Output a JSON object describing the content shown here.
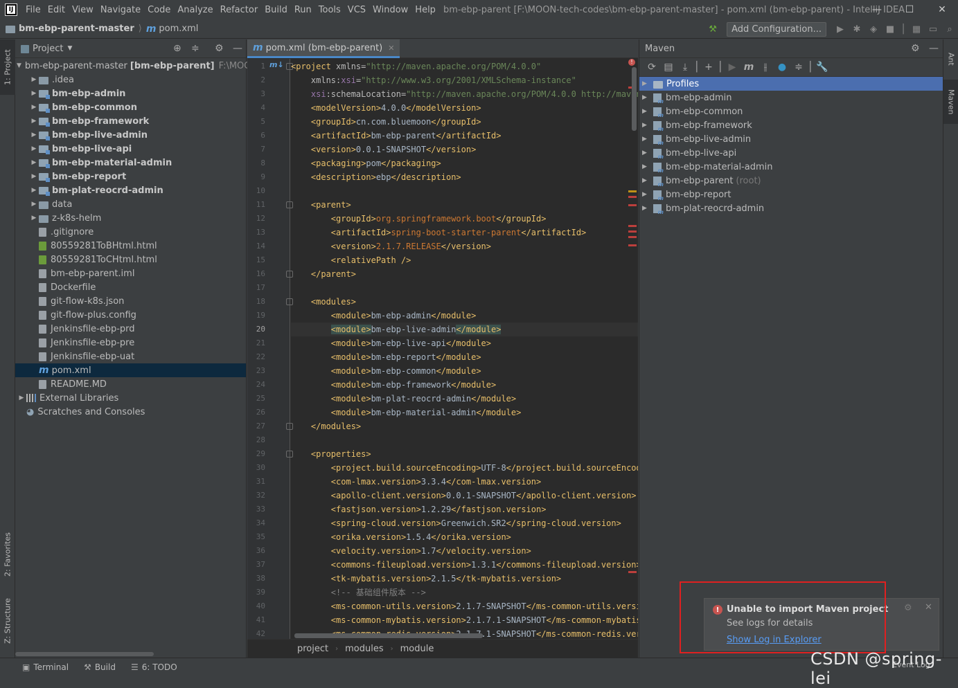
{
  "window": {
    "title": "bm-ebp-parent [F:\\MOON-tech-codes\\bm-ebp-parent-master] - pom.xml (bm-ebp-parent) - IntelliJ IDEA",
    "menu": [
      "File",
      "Edit",
      "View",
      "Navigate",
      "Code",
      "Analyze",
      "Refactor",
      "Build",
      "Run",
      "Tools",
      "VCS",
      "Window",
      "Help"
    ],
    "minimize": "—",
    "maximize": "☐",
    "close": "✕"
  },
  "nav": {
    "root": "bm-ebp-parent-master",
    "file": "pom.xml",
    "add_config": "Add Configuration..."
  },
  "left_tabs": {
    "project": "1: Project",
    "favorites": "2: Favorites",
    "structure": "Z: Structure"
  },
  "right_tabs": {
    "ant": "Ant",
    "maven": "Maven"
  },
  "project": {
    "header": "Project",
    "root_name": "bm-ebp-parent-master",
    "root_module": "[bm-ebp-parent]",
    "root_path": "F:\\MOO",
    "items": [
      {
        "label": ".idea",
        "kind": "folder",
        "bold": false
      },
      {
        "label": "bm-ebp-admin",
        "kind": "module",
        "bold": true
      },
      {
        "label": "bm-ebp-common",
        "kind": "module",
        "bold": true
      },
      {
        "label": "bm-ebp-framework",
        "kind": "module",
        "bold": true
      },
      {
        "label": "bm-ebp-live-admin",
        "kind": "module",
        "bold": true
      },
      {
        "label": "bm-ebp-live-api",
        "kind": "module",
        "bold": true
      },
      {
        "label": "bm-ebp-material-admin",
        "kind": "module",
        "bold": true
      },
      {
        "label": "bm-ebp-report",
        "kind": "module",
        "bold": true
      },
      {
        "label": "bm-plat-reocrd-admin",
        "kind": "module",
        "bold": true
      },
      {
        "label": "data",
        "kind": "folder",
        "bold": false
      },
      {
        "label": "z-k8s-helm",
        "kind": "folder",
        "bold": false
      },
      {
        "label": ".gitignore",
        "kind": "file"
      },
      {
        "label": "80559281ToBHtml.html",
        "kind": "html"
      },
      {
        "label": "80559281ToCHtml.html",
        "kind": "html"
      },
      {
        "label": "bm-ebp-parent.iml",
        "kind": "file"
      },
      {
        "label": "Dockerfile",
        "kind": "file"
      },
      {
        "label": "git-flow-k8s.json",
        "kind": "file"
      },
      {
        "label": "git-flow-plus.config",
        "kind": "file"
      },
      {
        "label": "Jenkinsfile-ebp-prd",
        "kind": "file"
      },
      {
        "label": "Jenkinsfile-ebp-pre",
        "kind": "file"
      },
      {
        "label": "Jenkinsfile-ebp-uat",
        "kind": "file"
      },
      {
        "label": "pom.xml",
        "kind": "pom"
      },
      {
        "label": "README.MD",
        "kind": "file"
      }
    ],
    "external": "External Libraries",
    "scratches": "Scratches and Consoles"
  },
  "editor": {
    "tab": "pom.xml (bm-ebp-parent)",
    "current_line": 20,
    "crumbs": [
      "project",
      "modules",
      "module"
    ]
  },
  "code_lines": [
    {
      "n": 1,
      "parts": [
        [
          "tg",
          "<project "
        ],
        [
          "at",
          "xmlns="
        ],
        [
          "st",
          "\"http://maven.apache.org/POM/4.0.0\""
        ]
      ]
    },
    {
      "n": 2,
      "parts": [
        [
          "at",
          "    xmlns:"
        ],
        [
          "ns",
          "xsi"
        ],
        [
          "at",
          "="
        ],
        [
          "st",
          "\"http://www.w3.org/2001/XMLSchema-instance\""
        ]
      ]
    },
    {
      "n": 3,
      "parts": [
        [
          "ns",
          "    xsi"
        ],
        [
          "at",
          ":schemaLocation="
        ],
        [
          "st",
          "\"http://maven.apache.org/POM/4.0.0 http://maven.a"
        ]
      ]
    },
    {
      "n": 4,
      "parts": [
        [
          "tg",
          "    <modelVersion>"
        ],
        [
          "",
          "4.0.0"
        ],
        [
          "tg",
          "</modelVersion>"
        ]
      ]
    },
    {
      "n": 5,
      "parts": [
        [
          "tg",
          "    <groupId>"
        ],
        [
          "",
          "cn.com.bluemoon"
        ],
        [
          "tg",
          "</groupId>"
        ]
      ]
    },
    {
      "n": 6,
      "parts": [
        [
          "tg",
          "    <artifactId>"
        ],
        [
          "",
          "bm-ebp-parent"
        ],
        [
          "tg",
          "</artifactId>"
        ]
      ]
    },
    {
      "n": 7,
      "parts": [
        [
          "tg",
          "    <version>"
        ],
        [
          "",
          "0.0.1-SNAPSHOT"
        ],
        [
          "tg",
          "</version>"
        ]
      ]
    },
    {
      "n": 8,
      "parts": [
        [
          "tg",
          "    <packaging>"
        ],
        [
          "",
          "pom"
        ],
        [
          "tg",
          "</packaging>"
        ]
      ]
    },
    {
      "n": 9,
      "parts": [
        [
          "tg",
          "    <description>"
        ],
        [
          "",
          "ebp"
        ],
        [
          "tg",
          "</description>"
        ]
      ]
    },
    {
      "n": 10,
      "parts": []
    },
    {
      "n": 11,
      "parts": [
        [
          "tg",
          "    <parent>"
        ]
      ]
    },
    {
      "n": 12,
      "parts": [
        [
          "tg",
          "        <groupId>"
        ],
        [
          "rd",
          "org.springframework.boot"
        ],
        [
          "tg",
          "</groupId>"
        ]
      ]
    },
    {
      "n": 13,
      "parts": [
        [
          "tg",
          "        <artifactId>"
        ],
        [
          "rd",
          "spring-boot-starter-parent"
        ],
        [
          "tg",
          "</artifactId>"
        ]
      ]
    },
    {
      "n": 14,
      "parts": [
        [
          "tg",
          "        <version>"
        ],
        [
          "rd",
          "2.1.7.RELEASE"
        ],
        [
          "tg",
          "</version>"
        ]
      ]
    },
    {
      "n": 15,
      "parts": [
        [
          "tg",
          "        <relativePath />"
        ]
      ]
    },
    {
      "n": 16,
      "parts": [
        [
          "tg",
          "    </parent>"
        ]
      ]
    },
    {
      "n": 17,
      "parts": []
    },
    {
      "n": 18,
      "parts": [
        [
          "tg",
          "    <modules>"
        ]
      ]
    },
    {
      "n": 19,
      "parts": [
        [
          "tg",
          "        <module>"
        ],
        [
          "",
          "bm-ebp-admin"
        ],
        [
          "tg",
          "</module>"
        ]
      ]
    },
    {
      "n": 20,
      "parts": [
        [
          "",
          "        "
        ],
        [
          "tg hl",
          "<module>"
        ],
        [
          "",
          "bm-ebp-live-admin"
        ],
        [
          "tg hl",
          "</module>"
        ]
      ]
    },
    {
      "n": 21,
      "parts": [
        [
          "tg",
          "        <module>"
        ],
        [
          "",
          "bm-ebp-live-api"
        ],
        [
          "tg",
          "</module>"
        ]
      ]
    },
    {
      "n": 22,
      "parts": [
        [
          "tg",
          "        <module>"
        ],
        [
          "",
          "bm-ebp-report"
        ],
        [
          "tg",
          "</module>"
        ]
      ]
    },
    {
      "n": 23,
      "parts": [
        [
          "tg",
          "        <module>"
        ],
        [
          "",
          "bm-ebp-common"
        ],
        [
          "tg",
          "</module>"
        ]
      ]
    },
    {
      "n": 24,
      "parts": [
        [
          "tg",
          "        <module>"
        ],
        [
          "",
          "bm-ebp-framework"
        ],
        [
          "tg",
          "</module>"
        ]
      ]
    },
    {
      "n": 25,
      "parts": [
        [
          "tg",
          "        <module>"
        ],
        [
          "",
          "bm-plat-reocrd-admin"
        ],
        [
          "tg",
          "</module>"
        ]
      ]
    },
    {
      "n": 26,
      "parts": [
        [
          "tg",
          "        <module>"
        ],
        [
          "",
          "bm-ebp-material-admin"
        ],
        [
          "tg",
          "</module>"
        ]
      ]
    },
    {
      "n": 27,
      "parts": [
        [
          "tg",
          "    </modules>"
        ]
      ]
    },
    {
      "n": 28,
      "parts": []
    },
    {
      "n": 29,
      "parts": [
        [
          "tg",
          "    <properties>"
        ]
      ]
    },
    {
      "n": 30,
      "parts": [
        [
          "tg",
          "        <project.build.sourceEncoding>"
        ],
        [
          "",
          "UTF-8"
        ],
        [
          "tg",
          "</project.build.sourceEncodi"
        ]
      ]
    },
    {
      "n": 31,
      "parts": [
        [
          "tg",
          "        <com-lmax.version>"
        ],
        [
          "",
          "3.3.4"
        ],
        [
          "tg",
          "</com-lmax.version>"
        ]
      ]
    },
    {
      "n": 32,
      "parts": [
        [
          "tg",
          "        <apollo-client.version>"
        ],
        [
          "",
          "0.0.1-SNAPSHOT"
        ],
        [
          "tg",
          "</apollo-client.version>"
        ]
      ]
    },
    {
      "n": 33,
      "parts": [
        [
          "tg",
          "        <fastjson.version>"
        ],
        [
          "",
          "1.2.29"
        ],
        [
          "tg",
          "</fastjson.version>"
        ]
      ]
    },
    {
      "n": 34,
      "parts": [
        [
          "tg",
          "        <spring-cloud.version>"
        ],
        [
          "",
          "Greenwich.SR2"
        ],
        [
          "tg",
          "</spring-cloud.version>"
        ]
      ]
    },
    {
      "n": 35,
      "parts": [
        [
          "tg",
          "        <orika.version>"
        ],
        [
          "",
          "1.5.4"
        ],
        [
          "tg",
          "</orika.version>"
        ]
      ]
    },
    {
      "n": 36,
      "parts": [
        [
          "tg",
          "        <velocity.version>"
        ],
        [
          "",
          "1.7"
        ],
        [
          "tg",
          "</velocity.version>"
        ]
      ]
    },
    {
      "n": 37,
      "parts": [
        [
          "tg",
          "        <commons-fileupload.version>"
        ],
        [
          "",
          "1.3.1"
        ],
        [
          "tg",
          "</commons-fileupload.version>"
        ]
      ]
    },
    {
      "n": 38,
      "parts": [
        [
          "tg",
          "        <tk-mybatis.version>"
        ],
        [
          "",
          "2.1.5"
        ],
        [
          "tg",
          "</tk-mybatis.version>"
        ]
      ]
    },
    {
      "n": 39,
      "parts": [
        [
          "cm",
          "        <!-- 基础组件版本 -->"
        ]
      ]
    },
    {
      "n": 40,
      "parts": [
        [
          "tg",
          "        <ms-common-utils.version>"
        ],
        [
          "",
          "2.1.7-SNAPSHOT"
        ],
        [
          "tg",
          "</ms-common-utils.versio"
        ]
      ]
    },
    {
      "n": 41,
      "parts": [
        [
          "tg",
          "        <ms-common-mybatis.version>"
        ],
        [
          "",
          "2.1.7.1-SNAPSHOT"
        ],
        [
          "tg",
          "</ms-common-mybatis."
        ]
      ]
    },
    {
      "n": 42,
      "parts": [
        [
          "tg",
          "        <ms-common-redis.version>"
        ],
        [
          "",
          "2.1.7.1-SNAPSHOT"
        ],
        [
          "tg",
          "</ms-common-redis.vers"
        ]
      ]
    }
  ],
  "maven": {
    "header": "Maven",
    "profiles": "Profiles",
    "items": [
      "bm-ebp-admin",
      "bm-ebp-common",
      "bm-ebp-framework",
      "bm-ebp-live-admin",
      "bm-ebp-live-api",
      "bm-ebp-material-admin",
      "bm-ebp-parent",
      "bm-ebp-report",
      "bm-plat-reocrd-admin"
    ],
    "root_label": "(root)"
  },
  "notification": {
    "title": "Unable to import Maven project",
    "detail": "See logs for details",
    "link": "Show Log in Explorer"
  },
  "statusbar": {
    "terminal": "Terminal",
    "build": "Build",
    "todo": "6: TODO",
    "event_log": "Event Log"
  },
  "watermark": "CSDN @spring-lei",
  "colors": {
    "accent": "#4a88c7",
    "selection": "#0d293e",
    "maven_selection": "#4b6eaf",
    "error": "#c75450",
    "highlight_box": "#e02020"
  }
}
